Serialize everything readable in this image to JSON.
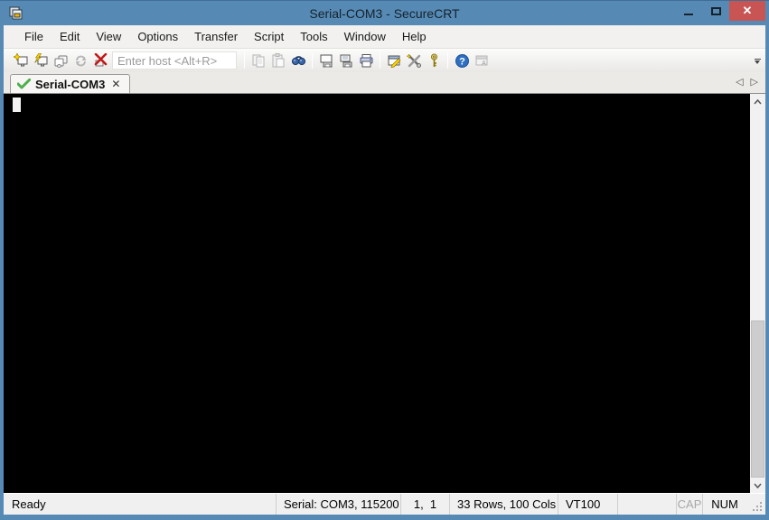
{
  "window": {
    "title": "Serial-COM3 - SecureCRT",
    "controls": {
      "close_glyph": "✕"
    }
  },
  "menu": {
    "items": [
      {
        "label": "File"
      },
      {
        "label": "Edit"
      },
      {
        "label": "View"
      },
      {
        "label": "Options"
      },
      {
        "label": "Transfer"
      },
      {
        "label": "Script"
      },
      {
        "label": "Tools"
      },
      {
        "label": "Window"
      },
      {
        "label": "Help"
      }
    ]
  },
  "toolbar": {
    "host_input": {
      "placeholder": "Enter host <Alt+R>",
      "value": ""
    },
    "buttons": [
      {
        "name": "connect",
        "enabled": true
      },
      {
        "name": "quick-connect",
        "enabled": true
      },
      {
        "name": "connect-in-tab",
        "enabled": true
      },
      {
        "name": "reconnect",
        "enabled": false
      },
      {
        "name": "disconnect",
        "enabled": true
      },
      {
        "name": "copy",
        "enabled": false
      },
      {
        "name": "paste",
        "enabled": false
      },
      {
        "name": "find",
        "enabled": true
      },
      {
        "name": "print-screen",
        "enabled": true
      },
      {
        "name": "print-eject",
        "enabled": true
      },
      {
        "name": "print",
        "enabled": true
      },
      {
        "name": "session-options",
        "enabled": true
      },
      {
        "name": "global-options",
        "enabled": true
      },
      {
        "name": "keymap",
        "enabled": true
      },
      {
        "name": "help",
        "enabled": true
      },
      {
        "name": "rename-tab",
        "enabled": false
      }
    ]
  },
  "tabbar": {
    "active_tab": {
      "label": "Serial-COM3",
      "status": "connected",
      "close_glyph": "✕"
    },
    "scroll_left_glyph": "◁",
    "scroll_right_glyph": "▷"
  },
  "terminal": {
    "content": "",
    "cursor_visible": true
  },
  "statusbar": {
    "ready": "Ready",
    "serial": "Serial: COM3, 115200",
    "cursor_position": "1,  1",
    "terminal_size": "33 Rows, 100 Cols",
    "emulation": "VT100",
    "cap_lock": "CAP",
    "num_lock": "NUM"
  },
  "colors": {
    "titlebar": "#568ab4",
    "close_button": "#c85454",
    "terminal_bg": "#000000",
    "chrome_bg": "#f0f0f0",
    "tab_check_green": "#4db04d"
  }
}
